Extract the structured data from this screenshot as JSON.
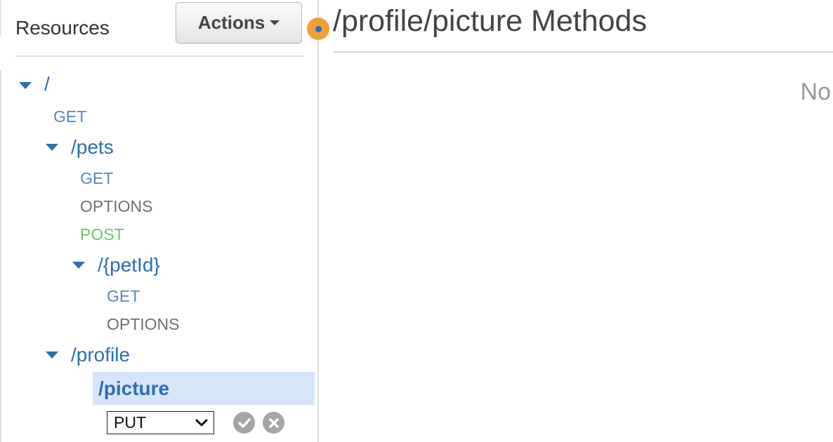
{
  "sidebar": {
    "title": "Resources",
    "actions_label": "Actions",
    "tree": {
      "root": {
        "path": "/",
        "methods": [
          "GET"
        ]
      },
      "pets": {
        "path": "/pets",
        "methods": [
          "GET",
          "OPTIONS",
          "POST"
        ]
      },
      "petId": {
        "path": "/{petId}",
        "methods": [
          "GET",
          "OPTIONS"
        ]
      },
      "profile": {
        "path": "/profile"
      },
      "picture": {
        "path": "/picture"
      }
    },
    "new_method": {
      "selected": "PUT",
      "confirm_icon": "check-circle-icon",
      "cancel_icon": "x-circle-icon"
    }
  },
  "main": {
    "title": "/profile/picture Methods",
    "empty_text": "No"
  },
  "colors": {
    "accent": "#2f6db5",
    "get": "#5b86bf",
    "options": "#707070",
    "post": "#6cc46c",
    "selected_bg": "#d6e6f8",
    "indicator": "#f0a03b"
  }
}
